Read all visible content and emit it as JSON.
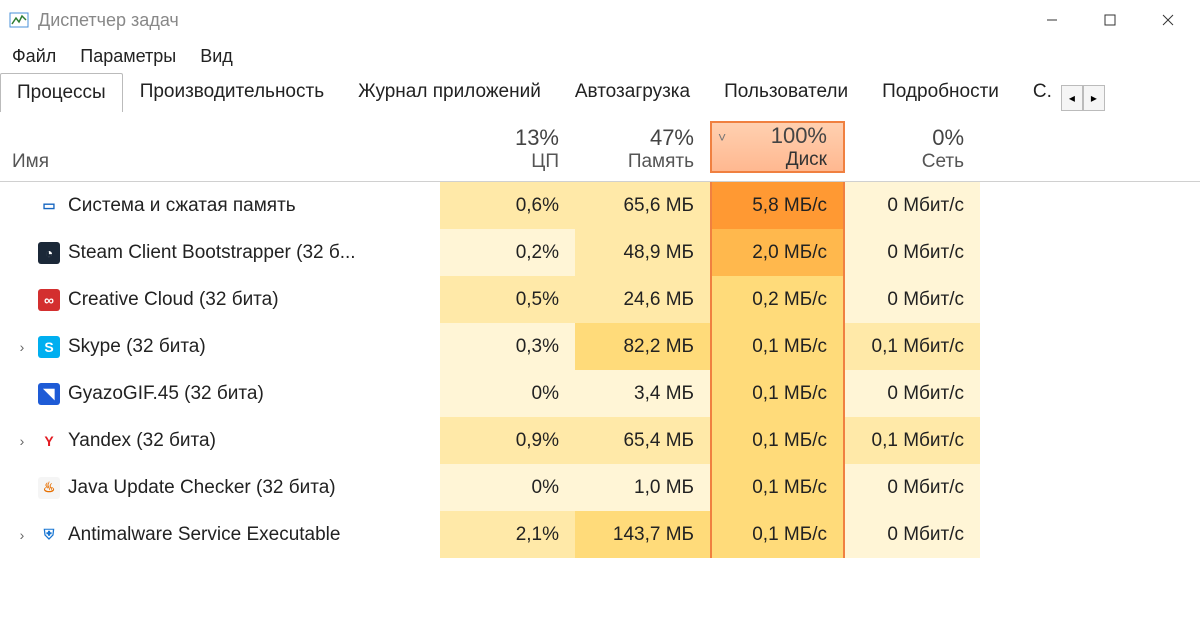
{
  "window": {
    "title": "Диспетчер задач"
  },
  "menu": [
    "Файл",
    "Параметры",
    "Вид"
  ],
  "tabs": [
    "Процессы",
    "Производительность",
    "Журнал приложений",
    "Автозагрузка",
    "Пользователи",
    "Подробности",
    "С."
  ],
  "columns": {
    "name": "Имя",
    "cpu": {
      "pct": "13%",
      "label": "ЦП"
    },
    "mem": {
      "pct": "47%",
      "label": "Память"
    },
    "disk": {
      "pct": "100%",
      "label": "Диск",
      "sorted": "desc"
    },
    "net": {
      "pct": "0%",
      "label": "Сеть"
    }
  },
  "processes": [
    {
      "expand": false,
      "icon": "system",
      "name": "Система и сжатая память",
      "cpu": "0,6%",
      "mem": "65,6 МБ",
      "disk": "5,8 МБ/с",
      "net": "0 Мбит/с",
      "heat": {
        "cpu": "heat-med",
        "mem": "heat-med",
        "disk": "heat-burn",
        "net": "heat-low"
      }
    },
    {
      "expand": false,
      "icon": "steam",
      "name": "Steam Client Bootstrapper (32 б...",
      "cpu": "0,2%",
      "mem": "48,9 МБ",
      "disk": "2,0 МБ/с",
      "net": "0 Мбит/с",
      "heat": {
        "cpu": "heat-low",
        "mem": "heat-med",
        "disk": "heat-hot",
        "net": "heat-low"
      }
    },
    {
      "expand": false,
      "icon": "adobe",
      "name": "Creative Cloud (32 бита)",
      "cpu": "0,5%",
      "mem": "24,6 МБ",
      "disk": "0,2 МБ/с",
      "net": "0 Мбит/с",
      "heat": {
        "cpu": "heat-med",
        "mem": "heat-med",
        "disk": "heat-high",
        "net": "heat-low"
      }
    },
    {
      "expand": true,
      "icon": "skype",
      "name": "Skype (32 бита)",
      "cpu": "0,3%",
      "mem": "82,2 МБ",
      "disk": "0,1 МБ/с",
      "net": "0,1 Мбит/с",
      "heat": {
        "cpu": "heat-low",
        "mem": "heat-high",
        "disk": "heat-high",
        "net": "heat-med"
      }
    },
    {
      "expand": false,
      "icon": "gyazo",
      "name": "GyazoGIF.45 (32 бита)",
      "cpu": "0%",
      "mem": "3,4 МБ",
      "disk": "0,1 МБ/с",
      "net": "0 Мбит/с",
      "heat": {
        "cpu": "heat-low",
        "mem": "heat-low",
        "disk": "heat-high",
        "net": "heat-low"
      }
    },
    {
      "expand": true,
      "icon": "yandex",
      "name": "Yandex (32 бита)",
      "cpu": "0,9%",
      "mem": "65,4 МБ",
      "disk": "0,1 МБ/с",
      "net": "0,1 Мбит/с",
      "heat": {
        "cpu": "heat-med",
        "mem": "heat-med",
        "disk": "heat-high",
        "net": "heat-med"
      }
    },
    {
      "expand": false,
      "icon": "java",
      "name": "Java Update Checker (32 бита)",
      "cpu": "0%",
      "mem": "1,0 МБ",
      "disk": "0,1 МБ/с",
      "net": "0 Мбит/с",
      "heat": {
        "cpu": "heat-low",
        "mem": "heat-low",
        "disk": "heat-high",
        "net": "heat-low"
      }
    },
    {
      "expand": true,
      "icon": "defender",
      "name": "Antimalware Service Executable",
      "cpu": "2,1%",
      "mem": "143,7 МБ",
      "disk": "0,1 МБ/с",
      "net": "0 Мбит/с",
      "heat": {
        "cpu": "heat-med",
        "mem": "heat-high",
        "disk": "heat-high",
        "net": "heat-low"
      }
    }
  ],
  "icons": {
    "system": {
      "bg": "#ffffff",
      "fg": "#1565c0",
      "glyph": "▭"
    },
    "steam": {
      "bg": "#1b2838",
      "fg": "#ffffff",
      "glyph": "◔"
    },
    "adobe": {
      "bg": "#d32f2f",
      "fg": "#ffffff",
      "glyph": "∞"
    },
    "skype": {
      "bg": "#00aff0",
      "fg": "#ffffff",
      "glyph": "S"
    },
    "gyazo": {
      "bg": "#1e5bd6",
      "fg": "#ffffff",
      "glyph": "◥"
    },
    "yandex": {
      "bg": "#ffffff",
      "fg": "#e21b22",
      "glyph": "Y"
    },
    "java": {
      "bg": "#f5f5f5",
      "fg": "#e76f00",
      "glyph": "♨"
    },
    "defender": {
      "bg": "#ffffff",
      "fg": "#1976d2",
      "glyph": "⛨"
    }
  }
}
